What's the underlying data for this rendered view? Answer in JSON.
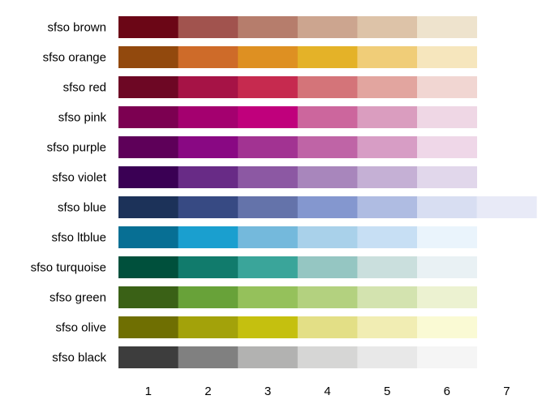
{
  "chart_data": {
    "type": "heatmap",
    "title": "",
    "xlabel": "",
    "ylabel": "",
    "x": [
      "1",
      "2",
      "3",
      "4",
      "5",
      "6",
      "7"
    ],
    "grid": false,
    "rows": [
      {
        "name": "sfso brown",
        "colors": [
          "#6B0616",
          "#A1534E",
          "#B67D6C",
          "#CCA58F",
          "#DDC3A8",
          "#EEE3CD"
        ]
      },
      {
        "name": "sfso orange",
        "colors": [
          "#92490D",
          "#CE6B29",
          "#DE9022",
          "#E4B228",
          "#F0CD78",
          "#F6E6BD"
        ]
      },
      {
        "name": "sfso red",
        "colors": [
          "#6D0724",
          "#A61346",
          "#C62A4F",
          "#D47479",
          "#E2A59F",
          "#F1D6D2"
        ]
      },
      {
        "name": "sfso pink",
        "colors": [
          "#7C0051",
          "#A4006F",
          "#C0007C",
          "#CC669D",
          "#DA9DBF",
          "#EFD7E5"
        ]
      },
      {
        "name": "sfso purple",
        "colors": [
          "#5E0059",
          "#890883",
          "#A23392",
          "#BF64A6",
          "#D79DC5",
          "#EFD7E8"
        ]
      },
      {
        "name": "sfso violet",
        "colors": [
          "#3A0054",
          "#682B86",
          "#8C58A3",
          "#A886BC",
          "#C5B0D5",
          "#E1D7EB"
        ]
      },
      {
        "name": "sfso blue",
        "colors": [
          "#1C3259",
          "#374A83",
          "#6473AA",
          "#8497CF",
          "#AFBCE2",
          "#D8DEF2",
          "#E8EAF7"
        ]
      },
      {
        "name": "sfso ltblue",
        "colors": [
          "#076F94",
          "#1A9FCF",
          "#74B9DC",
          "#A9D1EA",
          "#C7DFF4",
          "#EAF4FC"
        ]
      },
      {
        "name": "sfso turquoise",
        "colors": [
          "#00503C",
          "#117B6C",
          "#3AA59A",
          "#95C6C2",
          "#CADFDD",
          "#E9F1F4"
        ]
      },
      {
        "name": "sfso green",
        "colors": [
          "#3A6116",
          "#68A239",
          "#95C15B",
          "#B3D17F",
          "#D3E3AF",
          "#ECF2D1"
        ]
      },
      {
        "name": "sfso olive",
        "colors": [
          "#6F6F02",
          "#A3A20A",
          "#C5C00F",
          "#E3DF86",
          "#F1EDB3",
          "#FAFAD4"
        ]
      },
      {
        "name": "sfso black",
        "colors": [
          "#3D3D3D",
          "#808080",
          "#B2B2B1",
          "#D6D6D5",
          "#E8E8E8",
          "#F5F5F5"
        ]
      }
    ]
  }
}
